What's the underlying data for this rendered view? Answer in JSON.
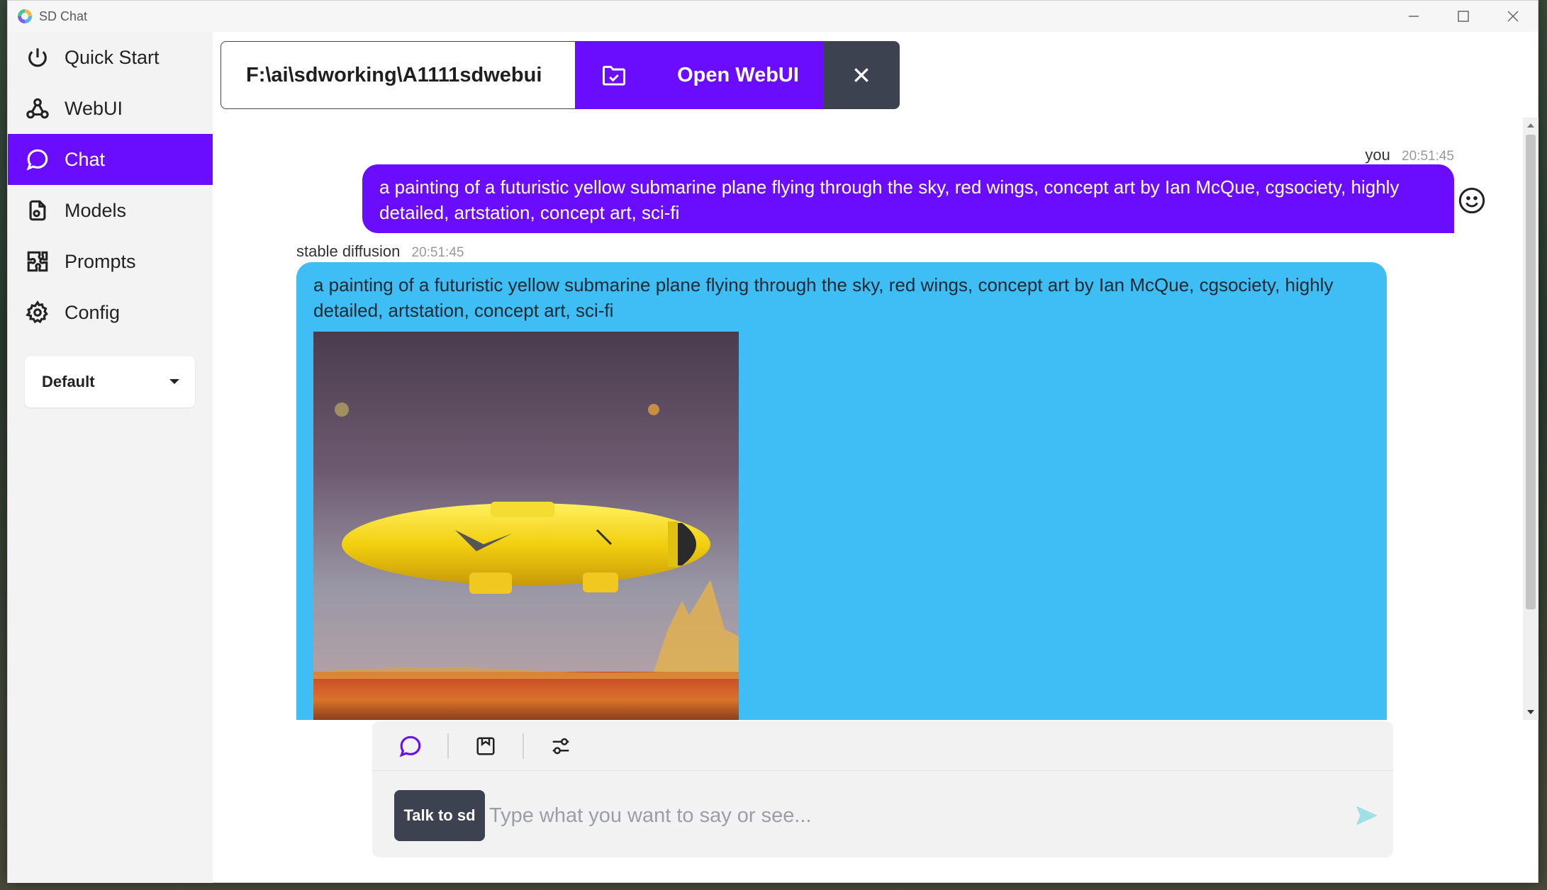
{
  "window": {
    "title": "SD Chat"
  },
  "sidebar": {
    "items": [
      {
        "label": "Quick Start",
        "icon": "power-icon"
      },
      {
        "label": "WebUI",
        "icon": "webhook-icon"
      },
      {
        "label": "Chat",
        "icon": "chat-bubble-icon",
        "active": true
      },
      {
        "label": "Models",
        "icon": "models-icon"
      },
      {
        "label": "Prompts",
        "icon": "puzzle-icon"
      },
      {
        "label": "Config",
        "icon": "gear-icon"
      }
    ],
    "profile": {
      "selected": "Default"
    }
  },
  "toolbar": {
    "path": "F:\\ai\\sdworking\\A1111sdwebui",
    "open_label": "Open WebUI"
  },
  "chat": {
    "messages": [
      {
        "sender": "you",
        "time": "20:51:45",
        "text": "a painting of a futuristic yellow submarine plane flying through the sky, red wings, concept art by Ian McQue, cgsociety, highly detailed, artstation, concept art, sci-fi"
      },
      {
        "sender": "stable diffusion",
        "time": "20:51:45",
        "text": "a painting of a futuristic yellow submarine plane flying through the sky, red wings, concept art by Ian McQue, cgsociety, highly detailed, artstation, concept art, sci-fi"
      }
    ]
  },
  "input": {
    "talk_label": "Talk to sd",
    "placeholder": "Type what you want to say or see..."
  },
  "colors": {
    "accent": "#6a0dff",
    "bot_bubble": "#3ebef5",
    "dark_button": "#3d4251"
  }
}
